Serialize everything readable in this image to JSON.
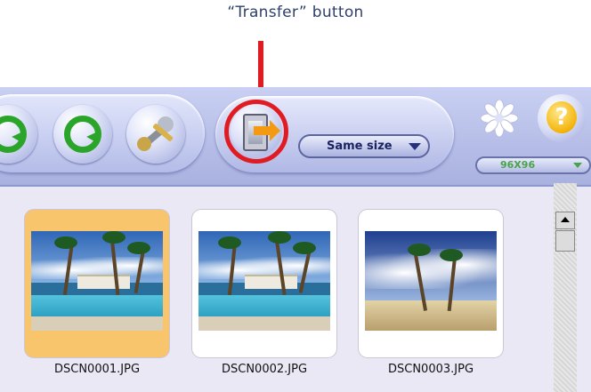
{
  "callout": {
    "text": "“Transfer” button"
  },
  "toolbar": {
    "size_select": "Same size",
    "thumb_size_select": "96X96",
    "help_label": "?"
  },
  "colors": {
    "accent_highlight": "#e01b22",
    "toolbar_bg": "#b7bfe8",
    "selection": "#f9c56c"
  },
  "files": [
    {
      "name": "DSCN0001.JPG",
      "selected": true
    },
    {
      "name": "DSCN0002.JPG",
      "selected": false
    },
    {
      "name": "DSCN0003.JPG",
      "selected": false
    }
  ]
}
